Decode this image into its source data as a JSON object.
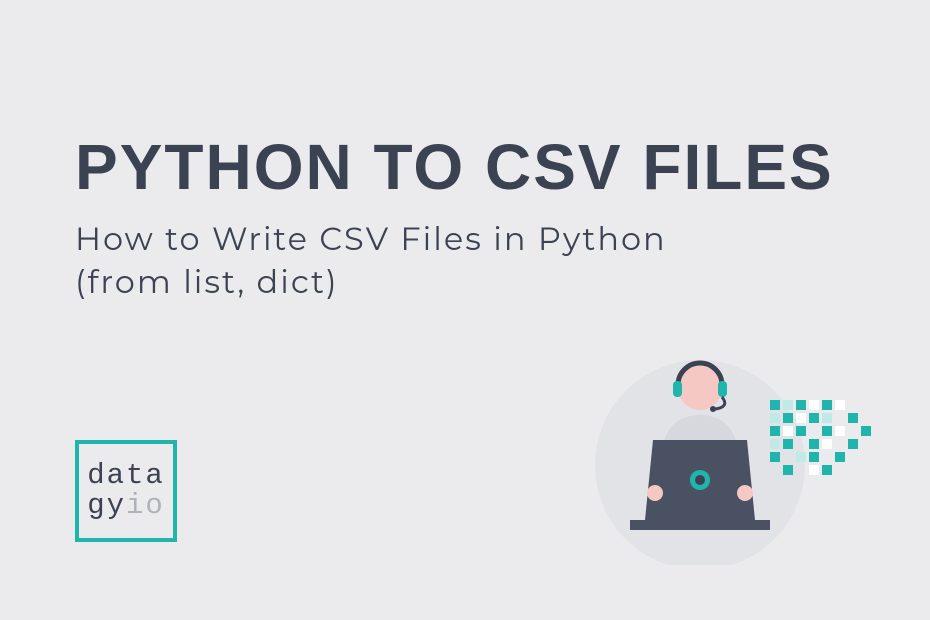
{
  "heading": "PYTHON TO CSV FILES",
  "subheading": "How to Write CSV Files in Python\n(from list, dict)",
  "logo": {
    "line1": "data",
    "line2_a": "gy",
    "line2_b": "io"
  },
  "colors": {
    "accent": "#1fb5ac",
    "dark": "#3b4353",
    "muted": "#aeb2bb",
    "bg": "#ebebed",
    "skin": "#f5c8c3",
    "sweater": "#d6d8dd"
  }
}
